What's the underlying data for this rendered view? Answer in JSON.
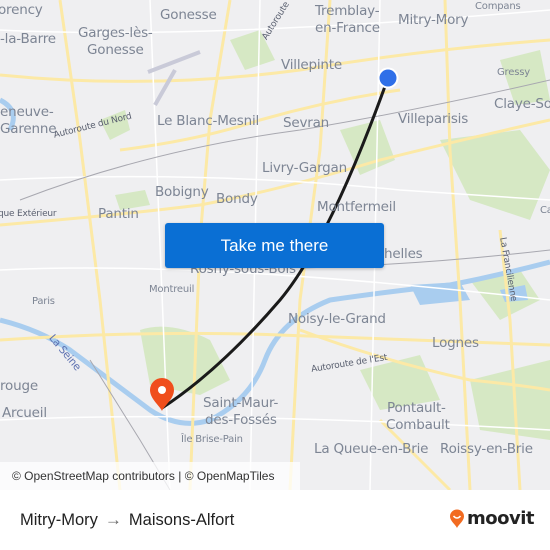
{
  "map": {
    "places": [
      {
        "id": "montmorency",
        "label": "orency"
      },
      {
        "id": "gonesse",
        "label": "Gonesse"
      },
      {
        "id": "tremblay-1",
        "label": "Tremblay-"
      },
      {
        "id": "tremblay-2",
        "label": "en-France"
      },
      {
        "id": "mitry-mory",
        "label": "Mitry-Mory"
      },
      {
        "id": "compans",
        "label": "Compans"
      },
      {
        "id": "la-barre",
        "label": "-la-Barre"
      },
      {
        "id": "garges-1",
        "label": "Garges-lès-"
      },
      {
        "id": "garges-2",
        "label": "Gonesse"
      },
      {
        "id": "villepinte",
        "label": "Villepinte"
      },
      {
        "id": "gressy",
        "label": "Gressy"
      },
      {
        "id": "claye",
        "label": "Claye-So"
      },
      {
        "id": "villeneuve-1",
        "label": "eneuve-"
      },
      {
        "id": "villeneuve-2",
        "label": "Garenne"
      },
      {
        "id": "blanc-mesnil",
        "label": "Le Blanc-Mesnil"
      },
      {
        "id": "sevran",
        "label": "Sevran"
      },
      {
        "id": "villeparisis",
        "label": "Villeparisis"
      },
      {
        "id": "livry",
        "label": "Livry-Gargan"
      },
      {
        "id": "bobigny",
        "label": "Bobigny"
      },
      {
        "id": "bondy",
        "label": "Bondy"
      },
      {
        "id": "montfermeil",
        "label": "Montfermeil"
      },
      {
        "id": "pantin",
        "label": "Pantin"
      },
      {
        "id": "chelles",
        "label": "helles"
      },
      {
        "id": "rosny",
        "label": "Rosny-sous-Bois"
      },
      {
        "id": "paris",
        "label": "Paris"
      },
      {
        "id": "montreuil",
        "label": "Montreuil"
      },
      {
        "id": "noisy",
        "label": "Noisy-le-Grand"
      },
      {
        "id": "lognes",
        "label": "Lognes"
      },
      {
        "id": "gentilly",
        "label": "rouge"
      },
      {
        "id": "arcueil",
        "label": "Arcueil"
      },
      {
        "id": "saint-maur-1",
        "label": "Saint-Maur-"
      },
      {
        "id": "saint-maur-2",
        "label": "des-Fossés"
      },
      {
        "id": "pontault-1",
        "label": "Pontault-"
      },
      {
        "id": "pontault-2",
        "label": "Combault"
      },
      {
        "id": "ile-brise-pain",
        "label": "Île Brise-Pain"
      },
      {
        "id": "queue-en-brie",
        "label": "La Queue-en-Brie"
      },
      {
        "id": "roissy-en-brie",
        "label": "Roissy-en-Brie"
      },
      {
        "id": "ca",
        "label": "Ca"
      }
    ],
    "roads": [
      {
        "id": "autoroute-nord",
        "label": "Autoroute du Nord"
      },
      {
        "id": "autoroute-top",
        "label": "Autoroute"
      },
      {
        "id": "peripherique",
        "label": "que Extérieur"
      },
      {
        "id": "autoroute-est",
        "label": "Autoroute de l'Est"
      },
      {
        "id": "francilienne",
        "label": "La Francilienne"
      }
    ],
    "water": [
      {
        "id": "la-seine",
        "label": "La Seine"
      }
    ],
    "origin_marker": {
      "name": "Mitry-Mory",
      "color": "#2f6fe8"
    },
    "destination_marker": {
      "name": "Maisons-Alfort",
      "color": "#f04e1c"
    },
    "route_color": "#1a1a1a",
    "cta_label": "Take me there",
    "attribution": {
      "osm": "© OpenStreetMap contributors",
      "separator": " | ",
      "omt": "© OpenMapTiles"
    }
  },
  "footer": {
    "origin": "Mitry-Mory",
    "arrow": "→",
    "destination": "Maisons-Alfort",
    "brand": "moovit",
    "brand_color": "#f26b21"
  }
}
